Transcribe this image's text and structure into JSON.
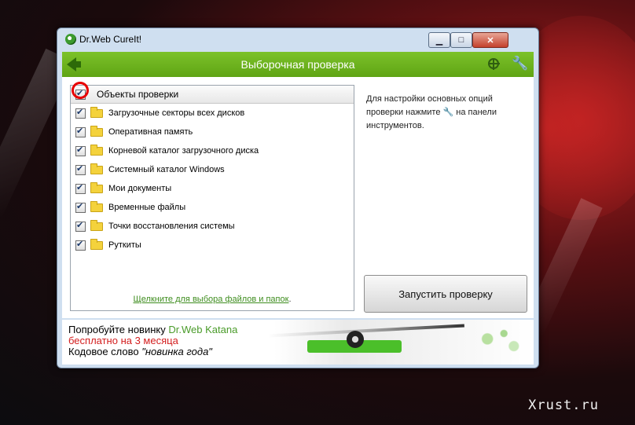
{
  "window": {
    "title": "Dr.Web CureIt!",
    "buttons": {
      "minimize": "▁",
      "maximize": "□",
      "close": "✕"
    }
  },
  "toolbar": {
    "title": "Выборочная проверка",
    "icons": [
      "arrow-left-icon",
      "globe-icon",
      "wrench-icon"
    ]
  },
  "tree": {
    "header": {
      "label": "Объекты проверки",
      "checked": true
    },
    "items": [
      {
        "label": "Загрузочные секторы всех дисков",
        "checked": true
      },
      {
        "label": "Оперативная память",
        "checked": true
      },
      {
        "label": "Корневой каталог загрузочного диска",
        "checked": true
      },
      {
        "label": "Системный каталог Windows",
        "checked": true
      },
      {
        "label": "Мои документы",
        "checked": true
      },
      {
        "label": "Временные файлы",
        "checked": true
      },
      {
        "label": "Точки восстановления системы",
        "checked": true
      },
      {
        "label": "Руткиты",
        "checked": true
      }
    ],
    "link_text": "Щелкните для выбора файлов и папок",
    "link_suffix": "."
  },
  "hint": {
    "part1": "Для настройки основных опций проверки нажмите",
    "part2": "на панели инструментов."
  },
  "start_button": "Запустить проверку",
  "banner": {
    "line1_prefix": "Попробуйте новинку",
    "line1_brand": "Dr.Web Katana",
    "line2": "бесплатно на 3 месяца",
    "line3_prefix": "Кодовое слово",
    "line3_quote": "\"новинка года\""
  },
  "watermark": "Xrust.ru",
  "colors": {
    "accent_green": "#6cb01e",
    "highlight_red": "#e80000",
    "link_green": "#3e8d1e"
  }
}
